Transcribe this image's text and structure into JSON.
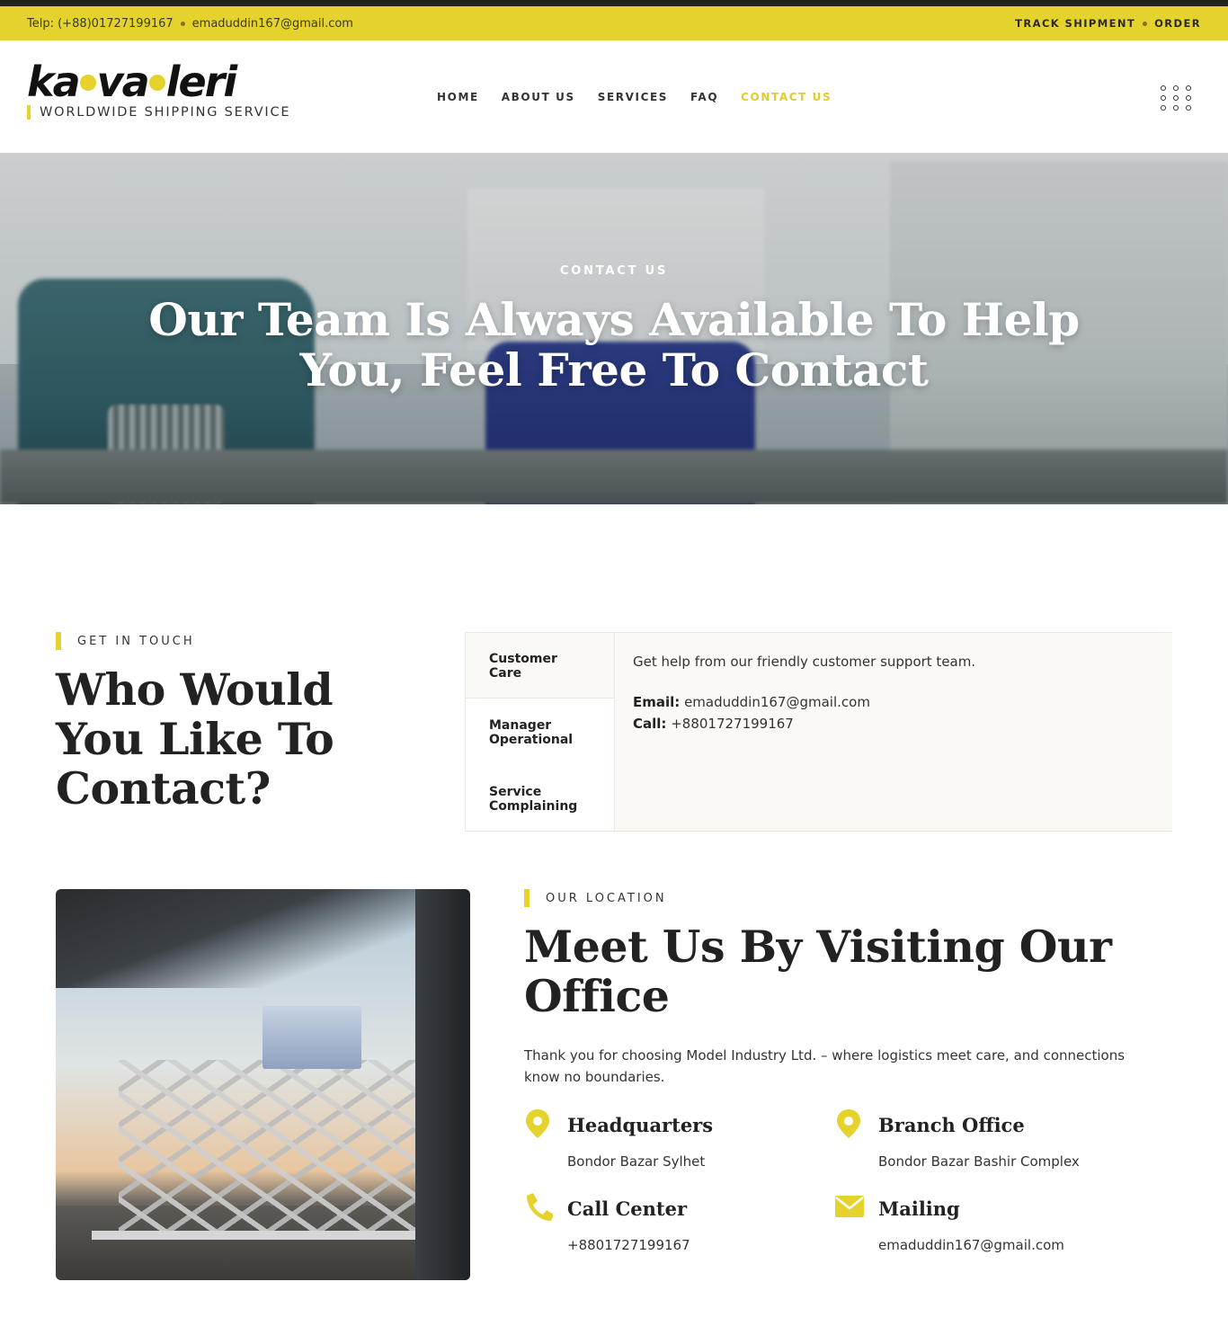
{
  "topbar": {
    "phone": "Telp: (+88)01727199167",
    "email": "emaduddin167@gmail.com",
    "links": [
      "TRACK SHIPMENT",
      "ORDER"
    ]
  },
  "brand": {
    "name_part1": "ka",
    "name_part2": "va",
    "name_part3": "leri",
    "tagline": "WORLDWIDE SHIPPING SERVICE",
    "accent_color": "#e6d22c"
  },
  "nav": {
    "items": [
      "HOME",
      "ABOUT US",
      "SERVICES",
      "FAQ",
      "CONTACT US"
    ],
    "active": "CONTACT US"
  },
  "hero": {
    "eyebrow": "CONTACT US",
    "title": "Our Team Is Always Available To Help You, Feel Free To Contact"
  },
  "contact": {
    "eyebrow": "GET IN TOUCH",
    "title": "Who Would You Like To Contact?",
    "tabs": [
      "Customer Care",
      "Manager Operational",
      "Service Complaining"
    ],
    "active_tab": "Customer Care",
    "panel": {
      "intro": "Get help from our friendly customer support team.",
      "email_label": "Email:",
      "email": "emaduddin167@gmail.com",
      "call_label": "Call:",
      "call": "+8801727199167"
    }
  },
  "location": {
    "eyebrow": "OUR LOCATION",
    "title": "Meet Us By Visiting Our Office",
    "text": "Thank you for choosing Model Industry Ltd. – where logistics meet care, and connections know no boundaries.",
    "cards": [
      {
        "icon": "map-pin-icon",
        "title": "Headquarters",
        "value": "Bondor Bazar Sylhet"
      },
      {
        "icon": "map-pin-icon",
        "title": "Branch Office",
        "value": "Bondor Bazar Bashir Complex"
      },
      {
        "icon": "phone-icon",
        "title": "Call Center",
        "value": "+8801727199167"
      },
      {
        "icon": "envelope-icon",
        "title": "Mailing",
        "value": "emaduddin167@gmail.com"
      }
    ]
  }
}
